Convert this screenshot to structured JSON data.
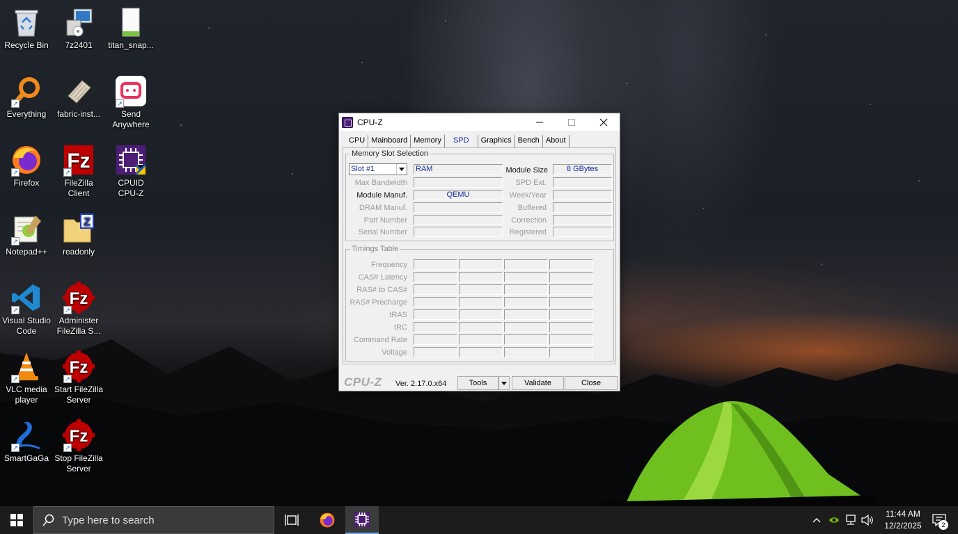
{
  "desktop": {
    "icons": [
      {
        "label": "Recycle Bin",
        "icon": "recycle-bin-icon"
      },
      {
        "label": "7z2401",
        "icon": "installer-icon"
      },
      {
        "label": "titan_snap...",
        "icon": "file-icon"
      },
      {
        "label": "Everything",
        "icon": "search-magnifier-icon"
      },
      {
        "label": "fabric-inst...",
        "icon": "jar-file-icon"
      },
      {
        "label": "Send\nAnywhere",
        "icon": "send-anywhere-icon"
      },
      {
        "label": "Firefox",
        "icon": "firefox-icon"
      },
      {
        "label": "FileZilla\nClient",
        "icon": "filezilla-icon"
      },
      {
        "label": "CPUID\nCPU-Z",
        "icon": "cpuz-icon"
      },
      {
        "label": "Notepad++",
        "icon": "notepadpp-icon"
      },
      {
        "label": "readonly",
        "icon": "folder-zip-icon"
      },
      {
        "label": "Visual Studio\nCode",
        "icon": "vscode-icon"
      },
      {
        "label": "Administer\nFileZilla S...",
        "icon": "filezilla-server-icon"
      },
      {
        "label": "VLC media\nplayer",
        "icon": "vlc-icon"
      },
      {
        "label": "Start FileZilla\nServer",
        "icon": "filezilla-server-icon"
      },
      {
        "label": "SmartGaGa",
        "icon": "smartgaga-icon"
      },
      {
        "label": "Stop FileZilla\nServer",
        "icon": "filezilla-server-icon"
      }
    ]
  },
  "window": {
    "title": "CPU-Z",
    "tabs": [
      "CPU",
      "Mainboard",
      "Memory",
      "SPD",
      "Graphics",
      "Bench",
      "About"
    ],
    "active_tab": "SPD",
    "slot_group": {
      "legend": "Memory Slot Selection",
      "selected_slot": "Slot #1",
      "type_value": "RAM",
      "module_size_label": "Module Size",
      "module_size_value": "8 GBytes",
      "max_bandwidth_label": "Max Bandwidth",
      "spd_ext_label": "SPD Ext.",
      "module_manuf_label": "Module Manuf.",
      "module_manuf_value": "QEMU",
      "week_year_label": "Week/Year",
      "dram_manuf_label": "DRAM Manuf.",
      "buffered_label": "Buffered",
      "part_number_label": "Part Number",
      "correction_label": "Correction",
      "serial_number_label": "Serial Number",
      "registered_label": "Registered"
    },
    "timings": {
      "legend": "Timings Table",
      "rows": [
        "Frequency",
        "CAS# Latency",
        "RAS# to CAS#",
        "RAS# Precharge",
        "tRAS",
        "tRC",
        "Command Rate",
        "Voltage"
      ]
    },
    "footer": {
      "brand": "CPU-Z",
      "version": "Ver. 2.17.0.x64",
      "tools_label": "Tools",
      "validate_label": "Validate",
      "close_label": "Close"
    }
  },
  "taskbar": {
    "search_placeholder": "Type here to search",
    "time": "11:44 AM",
    "date": "12/2/2025",
    "notification_count": "2"
  }
}
